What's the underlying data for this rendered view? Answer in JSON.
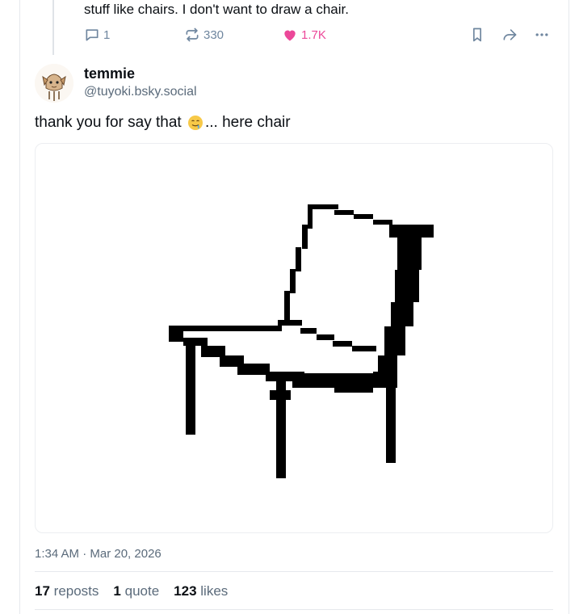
{
  "parent_post": {
    "text": "stuff like chairs. I don't want to draw a chair.",
    "reply_count": "1",
    "repost_count": "330",
    "like_count": "1.7K",
    "like_color": "#ec4899"
  },
  "post": {
    "author_name": "temmie",
    "author_handle": "@tuyoki.bsky.social",
    "text_before": "thank you for say that ",
    "emoji": "drooling-face",
    "text_after": "... here chair",
    "timestamp": "1:34 AM · Mar 20, 2026",
    "stats": {
      "reposts_count": "17",
      "reposts_label": "reposts",
      "quotes_count": "1",
      "quotes_label": "quote",
      "likes_count": "123",
      "likes_label": "likes"
    }
  },
  "icons": {
    "reply": "speech-bubble-icon",
    "repost": "repost-arrows-icon",
    "like": "heart-icon",
    "bookmark": "bookmark-icon",
    "share": "share-arrow-icon",
    "more": "ellipsis-icon"
  }
}
